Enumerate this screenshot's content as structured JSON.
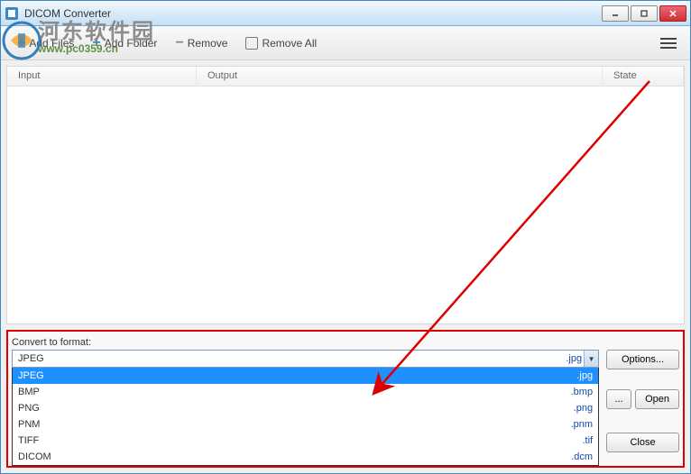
{
  "window": {
    "title": "DICOM Converter"
  },
  "toolbar": {
    "add_files": "Add Files",
    "add_folder": "Add Folder",
    "remove": "Remove",
    "remove_all": "Remove All"
  },
  "columns": {
    "input": "Input",
    "output": "Output",
    "state": "State"
  },
  "convert": {
    "label": "Convert to format:",
    "selected_name": "JPEG",
    "selected_ext": ".jpg",
    "options": [
      {
        "name": "JPEG",
        "ext": ".jpg",
        "selected": true
      },
      {
        "name": "BMP",
        "ext": ".bmp",
        "selected": false
      },
      {
        "name": "PNG",
        "ext": ".png",
        "selected": false
      },
      {
        "name": "PNM",
        "ext": ".pnm",
        "selected": false
      },
      {
        "name": "TIFF",
        "ext": ".tif",
        "selected": false
      },
      {
        "name": "DICOM",
        "ext": ".dcm",
        "selected": false
      }
    ]
  },
  "buttons": {
    "options": "Options...",
    "browse": "...",
    "open": "Open",
    "close": "Close"
  },
  "watermark": {
    "text": "河东软件园",
    "url": "www.pc0359.cn"
  }
}
